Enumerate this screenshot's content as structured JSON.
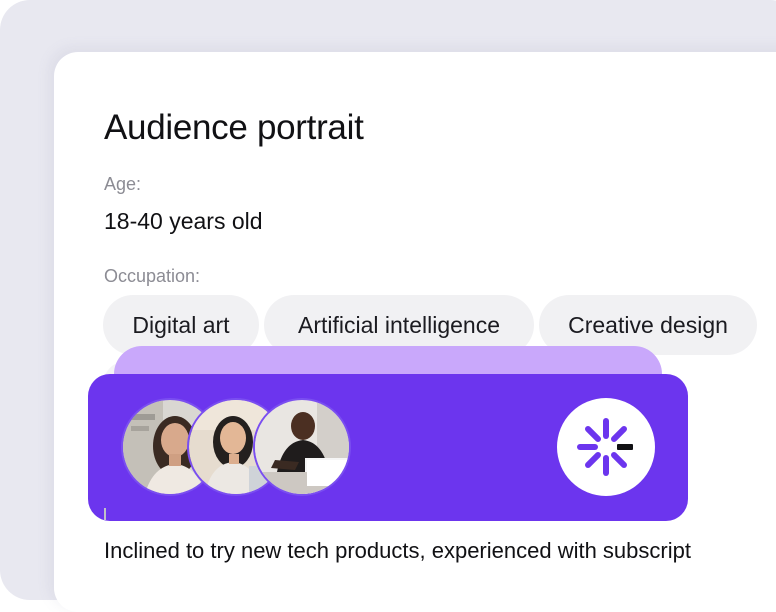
{
  "portrait": {
    "title": "Audience portrait",
    "age_label": "Age:",
    "age_value": "18-40 years old",
    "occupation_label": "Occupation:",
    "occupations": [
      "Digital art",
      "Artificial intelligence",
      "Creative design"
    ],
    "description": "Inclined to try new tech products, experienced with subscript"
  },
  "overlay": {
    "avatars": [
      "woman-portrait-avatar",
      "woman-with-laptop-avatar",
      "man-at-computer-avatar"
    ],
    "logo": "spark-logo-icon"
  },
  "colors": {
    "accent": "#6c35ee",
    "accent_light": "#c9a8fb",
    "chip_bg": "#f1f1f3",
    "label": "#8c8c94"
  }
}
